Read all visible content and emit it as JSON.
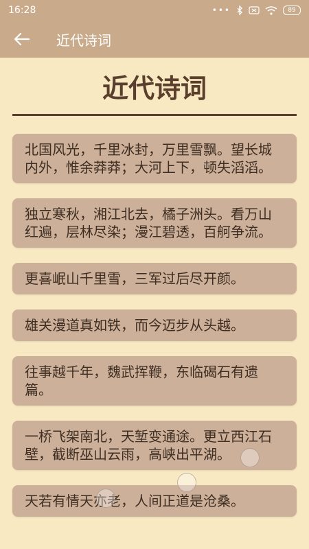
{
  "status": {
    "time": "16:28",
    "battery": "89",
    "icons": [
      "dots-icon",
      "bluetooth-icon",
      "sim-icon",
      "wifi-icon",
      "battery-icon"
    ]
  },
  "toolbar": {
    "title": "近代诗词"
  },
  "page": {
    "heading": "近代诗词"
  },
  "poems": [
    "北国风光，千里冰封，万里雪飘。望长城内外，惟余莽莽；大河上下，顿失滔滔。",
    "独立寒秋，湘江北去，橘子洲头。看万山红遍，层林尽染；漫江碧透，百舸争流。",
    "更喜岷山千里雪，三军过后尽开颜。",
    "雄关漫道真如铁，而今迈步从头越。",
    "往事越千年，魏武挥鞭，东临碣石有遗篇。",
    "一桥飞架南北，天堑变通途。更立西江石壁，截断巫山云雨，高峡出平湖。",
    "天若有情天亦老，人间正道是沧桑。"
  ],
  "colors": {
    "bar": "#c9ab8c",
    "background": "#f9e9c3",
    "card": "#cdb09a",
    "text": "#3e2e22",
    "heading": "#5a3f2c"
  }
}
